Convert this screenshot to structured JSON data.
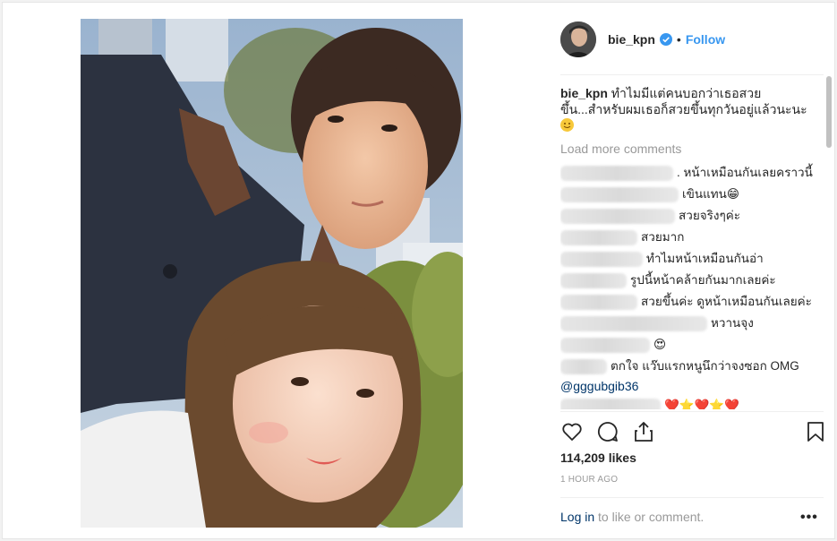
{
  "post": {
    "username": "bie_kpn",
    "dot": "•",
    "follow_label": "Follow",
    "caption_username": "bie_kpn",
    "caption_text": "ทำไมมีแต่คนบอกว่าเธอสวยขึ้น...สำหรับผมเธอก็สวยขึ้นทุกวันอยู่แล้วนะนะ",
    "load_more": "Load more comments",
    "comments": [
      {
        "text": ". หน้าเหมือนกันเลยคราวนี้"
      },
      {
        "text": "เขินแทน😁"
      },
      {
        "text": "สวยจริงๆค่ะ"
      },
      {
        "text": "สวยมาก"
      },
      {
        "text": "ทำไมหน้าเหมือนกันอ่า"
      },
      {
        "text": "รูปนี้หน้าคล้ายกันมากเลยค่ะ"
      },
      {
        "text": "สวยขึ้นค่ะ ดูหน้าเหมือนกันเลยค่ะ"
      },
      {
        "text": "หวานจุง"
      },
      {
        "text": "😍"
      },
      {
        "text": "ตกใจ แว๊บแรกหนูนึกว่าจงซอก OMG",
        "mention": "@gggubgib36"
      },
      {
        "text": "❤️⭐❤️⭐❤️"
      }
    ],
    "likes": "114,209 likes",
    "time": "1 HOUR AGO",
    "login_link": "Log in",
    "login_suffix": " to like or comment.",
    "more_label": "•••"
  },
  "icons": {
    "verified": "verified-badge-icon",
    "like": "heart-icon",
    "comment": "comment-bubble-icon",
    "share": "share-icon",
    "save": "bookmark-icon",
    "more": "more-options-icon"
  },
  "colors": {
    "accent": "#3897f0",
    "link": "#003569",
    "muted": "#999999",
    "text": "#262626"
  }
}
